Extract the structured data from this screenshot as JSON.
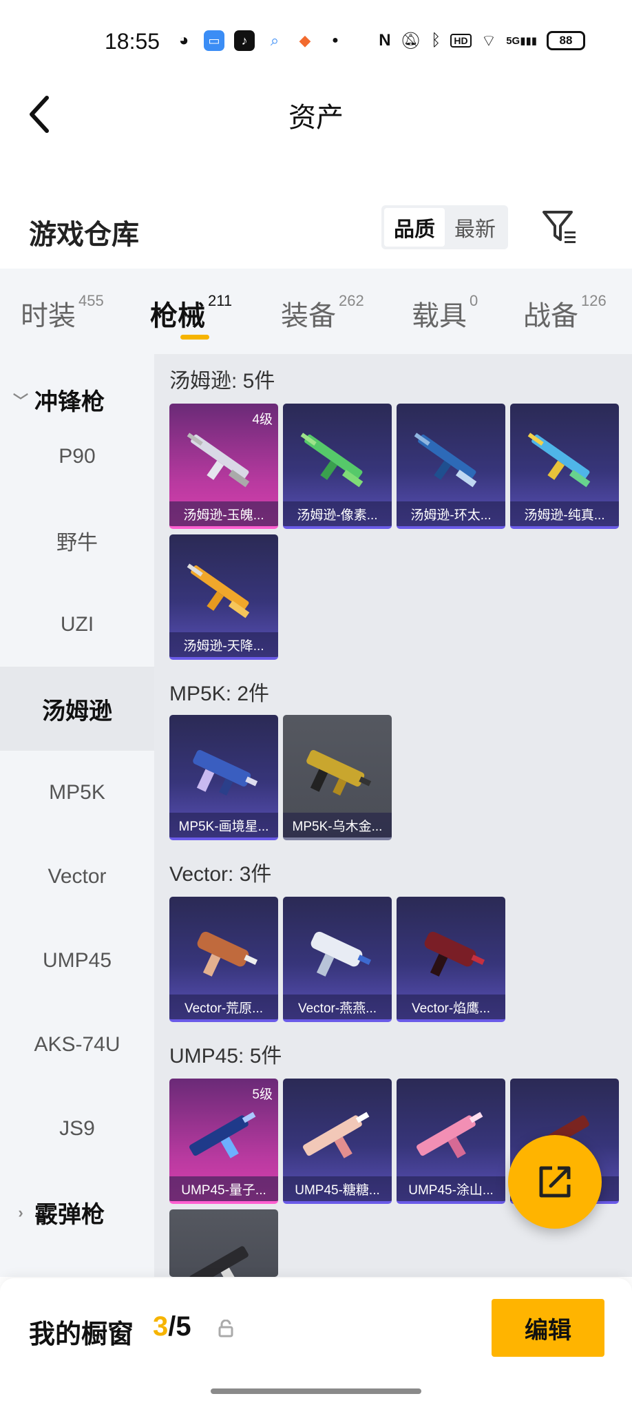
{
  "status_bar": {
    "time": "18:55",
    "signal": "5G",
    "battery": "88"
  },
  "header": {
    "title": "资产"
  },
  "section": {
    "title": "游戏仓库",
    "sort_options": [
      "品质",
      "最新"
    ],
    "sort_selected": "品质"
  },
  "tabs": [
    {
      "label": "时装",
      "count": "455"
    },
    {
      "label": "枪械",
      "count": "211"
    },
    {
      "label": "装备",
      "count": "262"
    },
    {
      "label": "载具",
      "count": "0"
    },
    {
      "label": "战备",
      "count": "126"
    }
  ],
  "sidebar": {
    "category_open": "冲锋枪",
    "items": [
      "P90",
      "野牛",
      "UZI",
      "汤姆逊",
      "MP5K",
      "Vector",
      "UMP45",
      "AKS-74U",
      "JS9"
    ],
    "active_item": "汤姆逊",
    "category_closed": "霰弹枪"
  },
  "groups": [
    {
      "title": "汤姆逊: 5件",
      "cards": [
        {
          "name": "汤姆逊-玉魄...",
          "level": "4级",
          "rarity": "pink"
        },
        {
          "name": "汤姆逊-像素...",
          "rarity": "purple"
        },
        {
          "name": "汤姆逊-环太...",
          "rarity": "purple"
        },
        {
          "name": "汤姆逊-纯真...",
          "rarity": "purple"
        },
        {
          "name": "汤姆逊-天降...",
          "rarity": "purple"
        }
      ]
    },
    {
      "title": "MP5K: 2件",
      "cards": [
        {
          "name": "MP5K-画境星...",
          "rarity": "purple"
        },
        {
          "name": "MP5K-乌木金...",
          "rarity": "gray"
        }
      ]
    },
    {
      "title": "Vector: 3件",
      "cards": [
        {
          "name": "Vector-荒原...",
          "rarity": "purple"
        },
        {
          "name": "Vector-燕燕...",
          "rarity": "purple"
        },
        {
          "name": "Vector-焰鹰...",
          "rarity": "purple"
        }
      ]
    },
    {
      "title": "UMP45: 5件",
      "cards": [
        {
          "name": "UMP45-量子...",
          "level": "5级",
          "rarity": "pink"
        },
        {
          "name": "UMP45-糖糖...",
          "rarity": "purple"
        },
        {
          "name": "UMP45-涂山...",
          "rarity": "purple"
        },
        {
          "name": "",
          "rarity": "purple"
        }
      ]
    }
  ],
  "bottom": {
    "showcase_label": "我的橱窗",
    "showcase_current": "3",
    "showcase_total": "/5",
    "edit_label": "编辑"
  },
  "colors": {
    "accent": "#ffb400",
    "rarity_purple": "#37357a",
    "rarity_pink": "#d83fae"
  }
}
